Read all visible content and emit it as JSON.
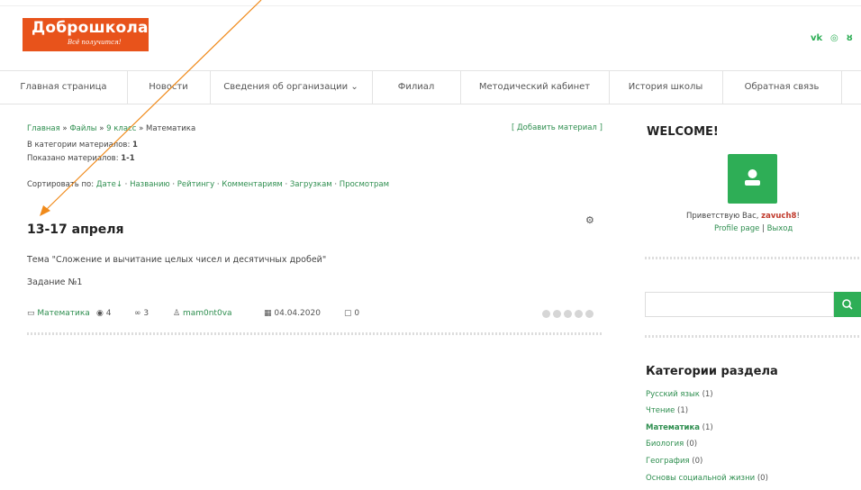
{
  "header": {
    "logo_title": "Доброшкола",
    "logo_tagline": "Всё получится!",
    "social": [
      "vk-icon",
      "instagram-icon",
      "odnoklassniki-icon"
    ],
    "social_labels": [
      "vk",
      "◎",
      "ȣ"
    ]
  },
  "nav": {
    "items": [
      "Главная страница",
      "Новости",
      "Сведения об организации",
      "Филиал",
      "Методический кабинет",
      "История школы",
      "Обратная связь"
    ],
    "dropdown_marker": "⌄"
  },
  "breadcrumb": {
    "home": "Главная",
    "sep": "»",
    "files": "Файлы",
    "grade": "9 класс",
    "current": "Математика"
  },
  "add_material": "[ Добавить материал ]",
  "category_count_label": "В категории материалов:",
  "category_count": "1",
  "shown_label": "Показано материалов:",
  "shown_range": "1-1",
  "sort": {
    "label": "Сортировать по:",
    "options": [
      "Дате",
      "Названию",
      "Рейтингу",
      "Комментариям",
      "Загрузкам",
      "Просмотрам"
    ],
    "date_marker": "↓",
    "sep": "·"
  },
  "entry": {
    "title": "13-17 апреля",
    "topic": "Тема \"Сложение и вычитание целых чисел и десятичных дробей\"",
    "task": "Задание №1",
    "category": "Математика",
    "views": "4",
    "downloads": "3",
    "author": "mam0nt0va",
    "date": "04.04.2020",
    "comments": "0",
    "rating": 0
  },
  "sidebar": {
    "welcome": "WELCOME!",
    "greeting": "Приветствую Вас,",
    "username": "zavuch8",
    "greeting_end": "!",
    "profile_link": "Profile page",
    "link_sep": "|",
    "logout_link": "Выход",
    "search_placeholder": "",
    "categories_title": "Категории раздела",
    "categories": [
      {
        "name": "Русский язык",
        "count": "(1)"
      },
      {
        "name": "Чтение",
        "count": "(1)"
      },
      {
        "name": "Математика",
        "count": "(1)",
        "active": true
      },
      {
        "name": "Биология",
        "count": "(0)"
      },
      {
        "name": "География",
        "count": "(0)"
      },
      {
        "name": "Основы социальной жизни",
        "count": "(0)"
      }
    ]
  },
  "colors": {
    "brand_orange": "#e8531b",
    "brand_green": "#2eae56",
    "annotation_arrow": "#f08a1a"
  }
}
